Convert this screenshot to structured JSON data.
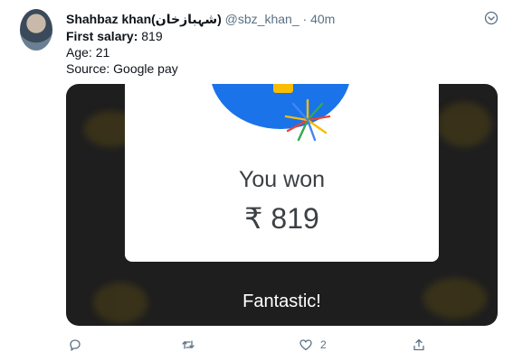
{
  "tweet": {
    "author_name": "Shahbaz khan(شہبازخان)",
    "handle": "@sbz_khan_",
    "separator": "·",
    "time": "40m",
    "lines": {
      "salary_label": "First salary:",
      "salary_value": " 819",
      "age": "Age: 21",
      "source": "Source: Google pay"
    },
    "media": {
      "won_text": "You won",
      "amount": "₹ 819",
      "fantastic": "Fantastic!"
    },
    "actions": {
      "reply_icon": "reply-icon",
      "retweet_icon": "retweet-icon",
      "like_icon": "heart-icon",
      "like_count": "2",
      "share_icon": "share-icon"
    },
    "more_icon": "chevron-down-icon"
  }
}
